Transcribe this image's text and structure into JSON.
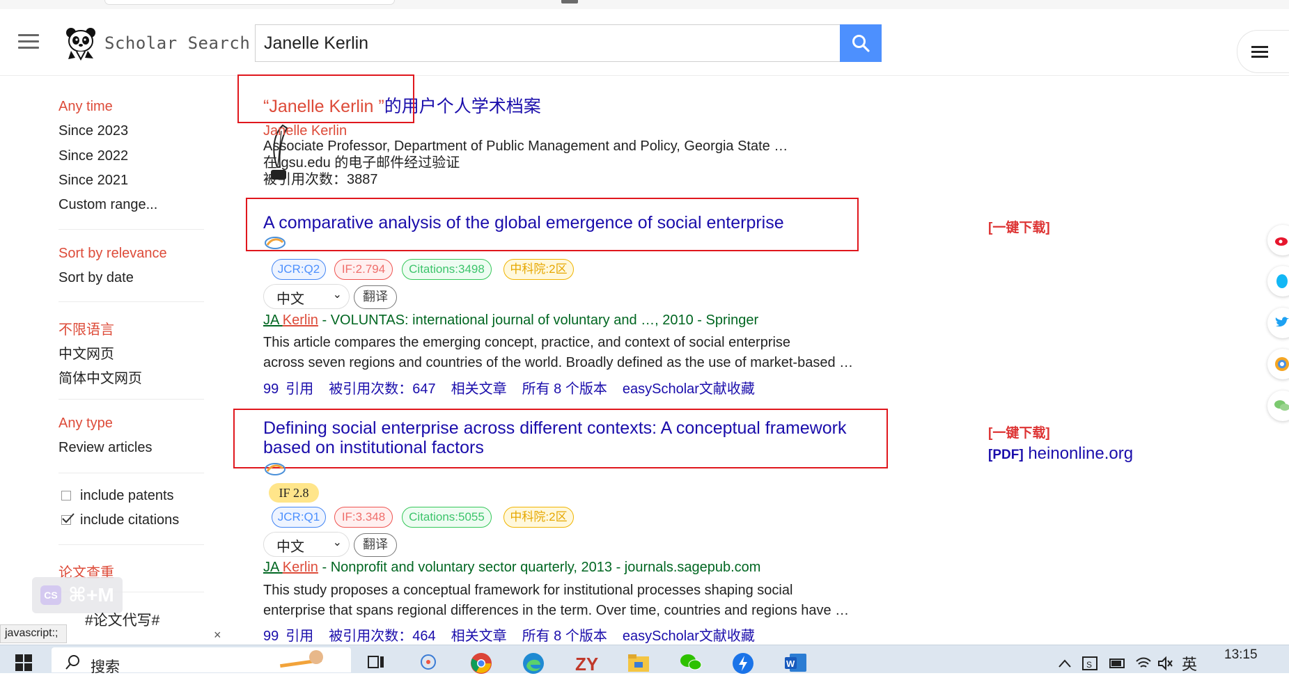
{
  "header": {
    "logo_text": "Scholar Search",
    "search_value": "Janelle Kerlin"
  },
  "sidebar": {
    "time_filters": [
      "Any time",
      "Since 2023",
      "Since 2022",
      "Since 2021",
      "Custom range..."
    ],
    "sort_options": [
      "Sort by relevance",
      "Sort by date"
    ],
    "language_options": [
      "不限语言",
      "中文网页",
      "简体中文网页"
    ],
    "type_options": [
      "Any type",
      "Review articles"
    ],
    "include_patents": "include patents",
    "include_citations": "include citations",
    "plagiarism_check": "论文查重",
    "overlay_shortcut": "⌘+M",
    "overlay_badge": "CS",
    "hashtag": "#论文代写#"
  },
  "status_bar": {
    "url": "javascript:;",
    "close": "×"
  },
  "profile": {
    "title_quoted": "“Janelle Kerlin ”",
    "title_suffix": "的用户个人学术档案",
    "name": "Janelle Kerlin",
    "affiliation": "Associate Professor, Department of Public Management and Policy, Georgia State …",
    "verified": "在 gsu.edu 的电子邮件经过验证",
    "citations": "被引用次数：3887"
  },
  "results": [
    {
      "title": "A comparative analysis of the global emergence of social enterprise",
      "badges": {
        "jcr": "JCR:Q2",
        "if": "IF:2.794",
        "citations": "Citations:3498",
        "cas": "中科院:2区"
      },
      "language": "中文",
      "translate": "翻译",
      "author_prefix": "JA ",
      "author": "Kerlin",
      "source": " - VOLUNTAS: international journal of voluntary and …, 2010 - Springer",
      "snippet1": "This article compares the emerging concept, practice, and context of social enterprise",
      "snippet2": "across seven regions and countries of the world. Broadly defined as the use of market-based …",
      "actions": {
        "quote_icon": "99",
        "cite": "引用",
        "cited_by": "被引用次数：647",
        "related": "相关文章",
        "versions": "所有 8 个版本",
        "collect": "easyScholar文献收藏"
      },
      "download": "[一键下载]"
    },
    {
      "title_line1": "Defining social enterprise across different contexts: A conceptual framework",
      "title_line2": "based on institutional factors",
      "if_badge": "IF 2.8",
      "badges": {
        "jcr": "JCR:Q1",
        "if": "IF:3.348",
        "citations": "Citations:5055",
        "cas": "中科院:2区"
      },
      "language": "中文",
      "translate": "翻译",
      "author_prefix": "JA ",
      "author": "Kerlin",
      "source": " - Nonprofit and voluntary sector quarterly, 2013 - journals.sagepub.com",
      "snippet1": "This study proposes a conceptual framework for institutional processes shaping social",
      "snippet2": "enterprise that spans regional differences in the term. Over time, countries and regions have …",
      "actions": {
        "quote_icon": "99",
        "cite": "引用",
        "cited_by": "被引用次数：464",
        "related": "相关文章",
        "versions": "所有 8 个版本",
        "collect": "easyScholar文献收藏"
      },
      "download": "[一键下载]",
      "pdf_tag": "[PDF]",
      "pdf_source": " heinonline.org"
    }
  ],
  "taskbar": {
    "search_label": "搜索",
    "lang_indicator": "英",
    "time": "13:15"
  },
  "colors": {
    "accent_blue": "#4d90fe",
    "link_blue": "#1a0dab",
    "filter_red": "#dd4b39",
    "source_green": "#006621",
    "annotation_red": "#e0171d"
  }
}
